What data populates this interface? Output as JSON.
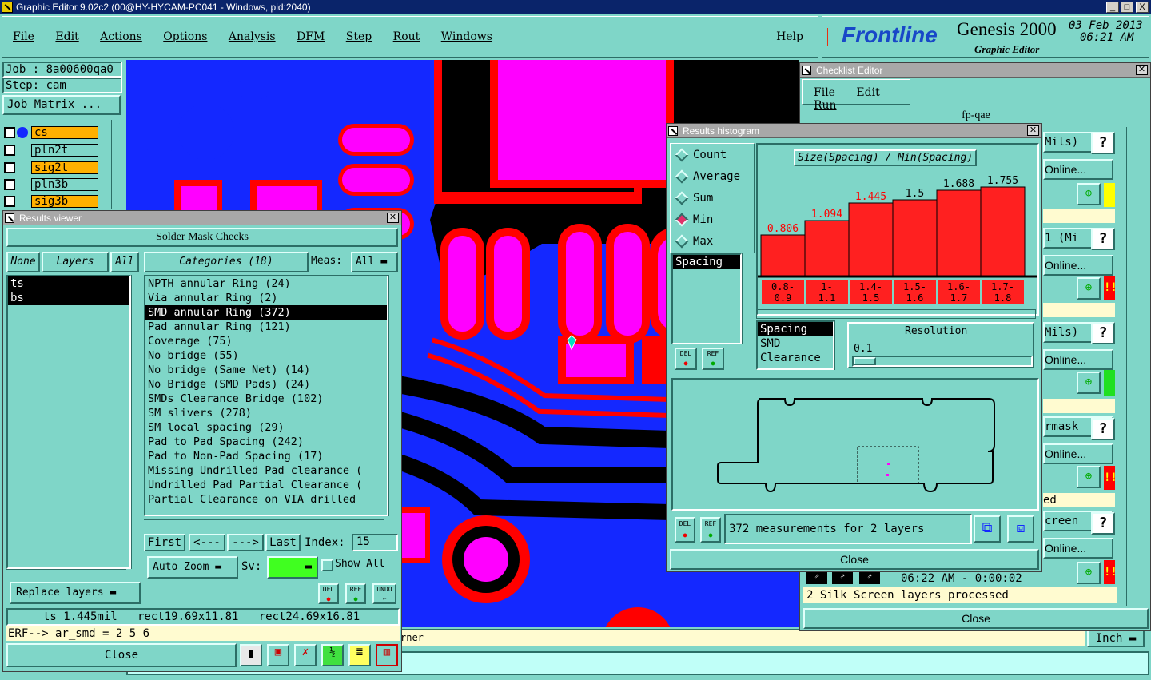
{
  "window": {
    "title": "Graphic Editor 9.02c2 (00@HY-HYCAM-PC041 - Windows, pid:2040)",
    "min": "_",
    "max": "□",
    "close": "X"
  },
  "menu": {
    "items": [
      "File",
      "Edit",
      "Actions",
      "Options",
      "Analysis",
      "DFM",
      "Step",
      "Rout",
      "Windows"
    ],
    "help": "Help"
  },
  "brand": {
    "logo": "Frontline",
    "product": "Genesis 2000",
    "subtitle": "Graphic Editor",
    "date": "03 Feb 2013",
    "time": "06:21 AM"
  },
  "job": {
    "job_label": "Job : 8a00600qa0",
    "step_label": "Step: cam",
    "matrix_button": "Job Matrix ..."
  },
  "layers": [
    {
      "name": "cs",
      "active": true
    },
    {
      "name": "pln2t",
      "active": false
    },
    {
      "name": "sig2t",
      "active": true
    },
    {
      "name": "pln3b",
      "active": false
    },
    {
      "name": "sig3b",
      "active": true
    }
  ],
  "results_viewer": {
    "title": "Results viewer",
    "header": "Solder Mask Checks",
    "none": "None",
    "layers_tab": "Layers",
    "all": "All",
    "categories_tab": "Categories (18)",
    "meas_label": "Meas:",
    "meas_value": "All",
    "layer_list": [
      "ts",
      "bs"
    ],
    "categories": [
      "NPTH annular Ring (24)",
      "Via annular Ring (2)",
      "SMD annular Ring (372)",
      "Pad annular Ring (121)",
      "Coverage (75)",
      "No bridge (55)",
      "No bridge (Same Net) (14)",
      "No Bridge (SMD Pads) (24)",
      "SMDs Clearance Bridge (102)",
      "SM slivers (278)",
      "SM local spacing (29)",
      "Pad to Pad Spacing (242)",
      "Pad to Non-Pad Spacing (17)",
      "Missing Undrilled Pad clearance (",
      "Undrilled Pad Partial Clearance (",
      "Partial Clearance on VIA drilled"
    ],
    "selected_index": 2,
    "first": "First",
    "prev": "<---",
    "next": "--->",
    "last": "Last",
    "index_label": "Index:",
    "index_value": "15",
    "auto_zoom": "Auto Zoom",
    "sv_label": "Sv:",
    "show_all": "Show All",
    "replace_layers": "Replace layers",
    "status": "ts 1.445mil   rect19.69x11.81   rect24.69x16.81",
    "erf": "ERF--> ar_smd = 2 5 6",
    "close": "Close",
    "del": "DEL",
    "ref": "REF",
    "undo": "UNDO"
  },
  "histogram": {
    "title": "Results histogram",
    "options": [
      "Count",
      "Average",
      "Sum",
      "Min",
      "Max"
    ],
    "selected_option": "Min",
    "chart_title": "Size(Spacing) / Min(Spacing)",
    "measure_list": [
      "Spacing"
    ],
    "filter_list": [
      "Spacing",
      "SMD",
      "Clearance"
    ],
    "resolution_label": "Resolution",
    "resolution_value": "0.1",
    "measurements": "372 measurements for 2 layers",
    "close": "Close",
    "del": "DEL",
    "ref": "REF"
  },
  "chart_data": {
    "type": "bar",
    "title": "Size(Spacing) / Min(Spacing)",
    "categories": [
      "0.8-0.9",
      "1-1.1",
      "1.4-1.5",
      "1.5-1.6",
      "1.6-1.7",
      "1.7-1.8"
    ],
    "cat_top": [
      "0.8-",
      "1-",
      "1.4-",
      "1.5-",
      "1.6-",
      "1.7-"
    ],
    "cat_bot": [
      "0.9",
      "1.1",
      "1.5",
      "1.6",
      "1.7",
      "1.8"
    ],
    "values": [
      0.806,
      1.094,
      1.445,
      1.5,
      1.688,
      1.755
    ],
    "value_labels": [
      "0.806",
      "1.094",
      "1.445",
      "1.5",
      "1.688",
      "1.755"
    ],
    "ylim": [
      0,
      1.9
    ],
    "colors": {
      "bar": "#ff2020",
      "value": "#ff0000"
    }
  },
  "checklist": {
    "title": "Checklist Editor",
    "menu": [
      "File",
      "Edit",
      "Run"
    ],
    "name": "fp-qae",
    "rows": [
      "Mils)",
      "Online...",
      "1 (Mi",
      "Online...",
      "Mils)",
      "Online...",
      "rmask",
      "Online...",
      "ed",
      "creen",
      "Online..."
    ],
    "timer": "06:22 AM - 0:00:02",
    "message": "2 Silk Screen layers processed",
    "close": "Close"
  },
  "bottom": {
    "corner_text": "rner",
    "unit": "Inch"
  }
}
